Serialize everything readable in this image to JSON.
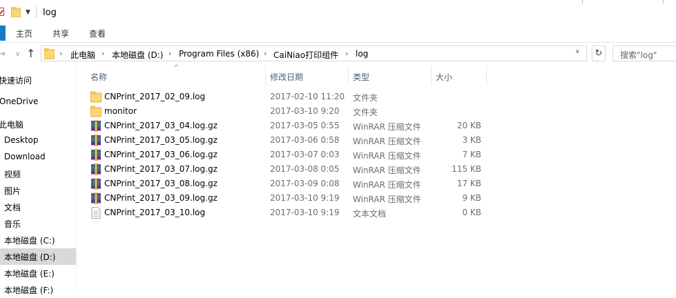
{
  "window": {
    "title": "log"
  },
  "ribbon": {
    "tabs": [
      "主页",
      "共享",
      "查看"
    ]
  },
  "address": {
    "crumbs": [
      "此电脑",
      "本地磁盘 (D:)",
      "Program Files (x86)",
      "CaiNiao打印组件",
      "log"
    ]
  },
  "search": {
    "placeholder": "搜索\"log\""
  },
  "sidebar": {
    "items": [
      {
        "label": "快速访问"
      },
      {
        "label": "OneDrive"
      },
      {
        "label": "此电脑"
      },
      {
        "label": "Desktop"
      },
      {
        "label": "Download"
      },
      {
        "label": "视频"
      },
      {
        "label": "图片"
      },
      {
        "label": "文档"
      },
      {
        "label": "音乐"
      },
      {
        "label": "本地磁盘 (C:)"
      },
      {
        "label": "本地磁盘 (D:)"
      },
      {
        "label": "本地磁盘 (E:)"
      },
      {
        "label": "本地磁盘 (F:)"
      }
    ]
  },
  "columns": {
    "name": "名称",
    "date": "修改日期",
    "type": "类型",
    "size": "大小"
  },
  "files": [
    {
      "icon": "folder-icon",
      "name": "CNPrint_2017_02_09.log",
      "date": "2017-02-10 11:20",
      "type": "文件夹",
      "size": ""
    },
    {
      "icon": "folder-icon",
      "name": "monitor",
      "date": "2017-03-10 9:20",
      "type": "文件夹",
      "size": ""
    },
    {
      "icon": "winrar-icon",
      "name": "CNPrint_2017_03_04.log.gz",
      "date": "2017-03-05 0:55",
      "type": "WinRAR 压缩文件",
      "size": "20 KB"
    },
    {
      "icon": "winrar-icon",
      "name": "CNPrint_2017_03_05.log.gz",
      "date": "2017-03-06 0:58",
      "type": "WinRAR 压缩文件",
      "size": "3 KB"
    },
    {
      "icon": "winrar-icon",
      "name": "CNPrint_2017_03_06.log.gz",
      "date": "2017-03-07 0:03",
      "type": "WinRAR 压缩文件",
      "size": "7 KB"
    },
    {
      "icon": "winrar-icon",
      "name": "CNPrint_2017_03_07.log.gz",
      "date": "2017-03-08 0:05",
      "type": "WinRAR 压缩文件",
      "size": "115 KB"
    },
    {
      "icon": "winrar-icon",
      "name": "CNPrint_2017_03_08.log.gz",
      "date": "2017-03-09 0:08",
      "type": "WinRAR 压缩文件",
      "size": "17 KB"
    },
    {
      "icon": "winrar-icon",
      "name": "CNPrint_2017_03_09.log.gz",
      "date": "2017-03-10 9:19",
      "type": "WinRAR 压缩文件",
      "size": "9 KB"
    },
    {
      "icon": "text-file-icon",
      "name": "CNPrint_2017_03_10.log",
      "date": "2017-03-10 9:19",
      "type": "文本文档",
      "size": "0 KB"
    }
  ]
}
